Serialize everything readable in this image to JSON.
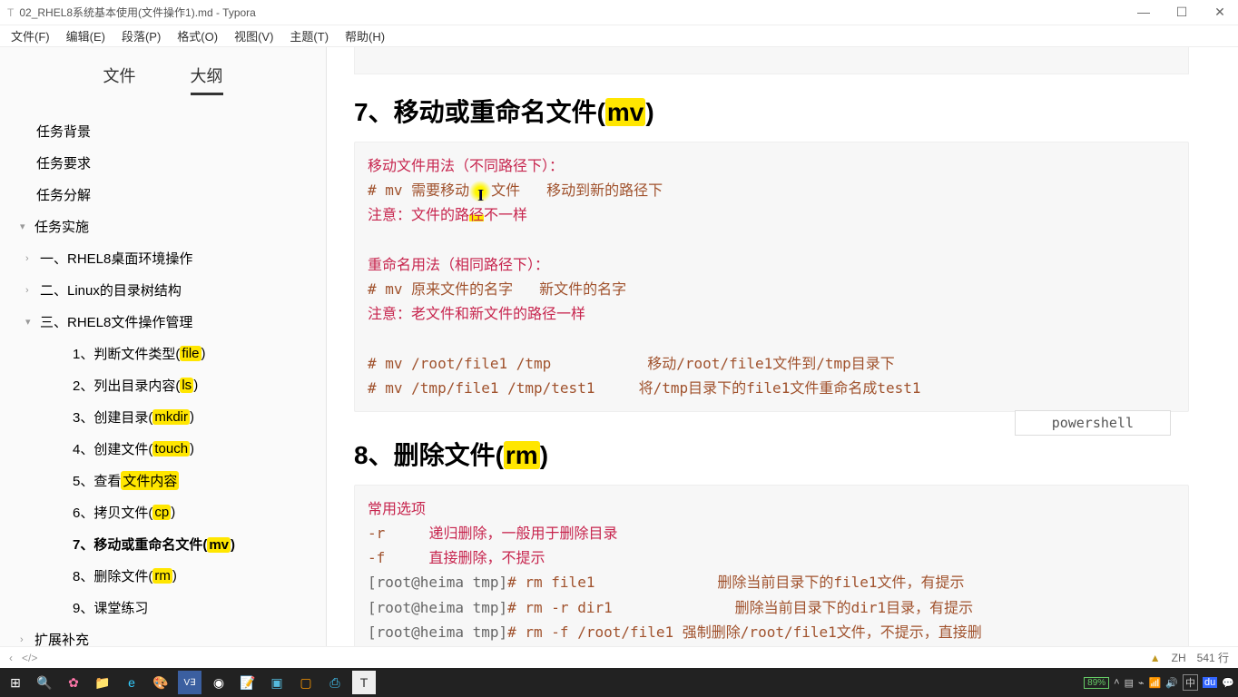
{
  "titlebar": {
    "text": "02_RHEL8系统基本使用(文件操作1).md - Typora"
  },
  "menubar": [
    "文件(F)",
    "编辑(E)",
    "段落(P)",
    "格式(O)",
    "视图(V)",
    "主题(T)",
    "帮助(H)"
  ],
  "sidebar": {
    "tabs": {
      "file": "文件",
      "outline": "大纲"
    },
    "outline": [
      {
        "lvl": 1,
        "text": "任务背景"
      },
      {
        "lvl": 1,
        "text": "任务要求"
      },
      {
        "lvl": 1,
        "text": "任务分解"
      },
      {
        "lvl": 1,
        "text": "任务实施",
        "chev": "▾"
      },
      {
        "lvl": 2,
        "text": "一、RHEL8桌面环境操作",
        "chev": "›"
      },
      {
        "lvl": 2,
        "text": "二、Linux的目录树结构",
        "chev": "›"
      },
      {
        "lvl": 2,
        "text": "三、RHEL8文件操作管理",
        "chev": "▾"
      },
      {
        "lvl": 4,
        "html": "1、判断文件类型(<span class='hl'>file</span>)"
      },
      {
        "lvl": 4,
        "html": "2、列出目录内容(<span class='hl'>ls</span>)"
      },
      {
        "lvl": 4,
        "html": "3、创建目录(<span class='hl'>mkdir</span>)"
      },
      {
        "lvl": 4,
        "html": "4、创建文件(<span class='hl'>touch</span>)"
      },
      {
        "lvl": 4,
        "html": "5、查看<span class='hl'>文件内容</span>"
      },
      {
        "lvl": 4,
        "html": "6、拷贝文件(<span class='hl'>cp</span>)"
      },
      {
        "lvl": 4,
        "html": "<b>7、移动或重命名文件(<span class='hl'>mv</span>)</b>",
        "bold": true
      },
      {
        "lvl": 4,
        "html": "8、删除文件(<span class='hl'>rm</span>)"
      },
      {
        "lvl": 4,
        "text": "9、课堂练习"
      },
      {
        "lvl": 1,
        "text": "扩展补充",
        "chev": "›"
      }
    ]
  },
  "content": {
    "h7_pre": "7、移动或重命名文件(",
    "h7_hl": "mv",
    "h7_post": ")",
    "block1": {
      "l1": "移动文件用法（不同路径下）：",
      "l2a": "# mv 需要移动",
      "l2b": "文件   移动到新的路径下",
      "l3a": "注意：文件的路",
      "l3b": "不一样",
      "blank": "",
      "l4": "重命名用法（相同路径下）：",
      "l5": "# mv 原来文件的名字   新文件的名字",
      "l6": "注意：老文件和新文件的路径一样",
      "l7a": "# mv /root/file1 /tmp",
      "l7b": "移动/root/file1文件到/tmp目录下",
      "l8a": "# mv /tmp/file1 /tmp/test1",
      "l8b": "将/tmp目录下的file1文件重命名成test1"
    },
    "langTag": "powershell",
    "h8_pre": "8、删除文件(",
    "h8_hl": "rm",
    "h8_post": ")",
    "block2": {
      "l1": "常用选项",
      "l2a": "-r",
      "l2b": "递归删除，一般用于删除目录",
      "l3a": "-f",
      "l3b": "直接删除，不提示",
      "l4a": "[root@heima tmp]",
      "l4b": "# rm file1",
      "l4c": "删除当前目录下的file1文件，有提示",
      "l5a": "[root@heima tmp]",
      "l5b": "# rm -r dir1",
      "l5c": "删除当前目录下的dir1目录，有提示",
      "l6a": "[root@heima tmp]",
      "l6b": "# rm -f /root/file1",
      "l6c": "强制删除/root/file1文件，不提示，直接删"
    }
  },
  "bottombar": {
    "left1": "‹",
    "left2": "</>",
    "warn": "▲",
    "lang": "ZH",
    "lines": "541 行"
  },
  "taskbar": {
    "battery": "89%"
  }
}
